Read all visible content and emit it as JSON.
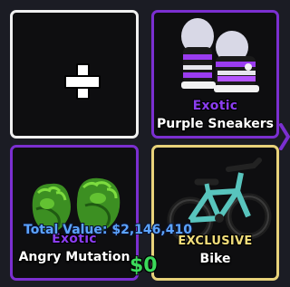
{
  "inventory": {
    "slots": [
      {
        "id": "add",
        "icon": "plus-icon"
      },
      {
        "id": "sneakers",
        "rarity": "Exotic",
        "name": "Purple Sneakers",
        "rarity_color": "#8b3df0",
        "border_color": "#7b2fd0",
        "icon": "sneakers-image"
      },
      {
        "id": "mutation",
        "rarity": "Exotic",
        "name": "Angry Mutation",
        "rarity_color": "#8b3df0",
        "border_color": "#7b2fd0",
        "icon": "green-fists-image"
      },
      {
        "id": "bike",
        "rarity": "EXCLUSIVE",
        "name": "Bike",
        "rarity_color": "#f1dd7a",
        "border_color": "#e8d27a",
        "icon": "bike-image"
      }
    ]
  },
  "summary": {
    "total_value": "Total Value: $2,146,410",
    "total_value_color": "#5ca4ff",
    "price": "$0",
    "price_color": "#3bd95a"
  }
}
